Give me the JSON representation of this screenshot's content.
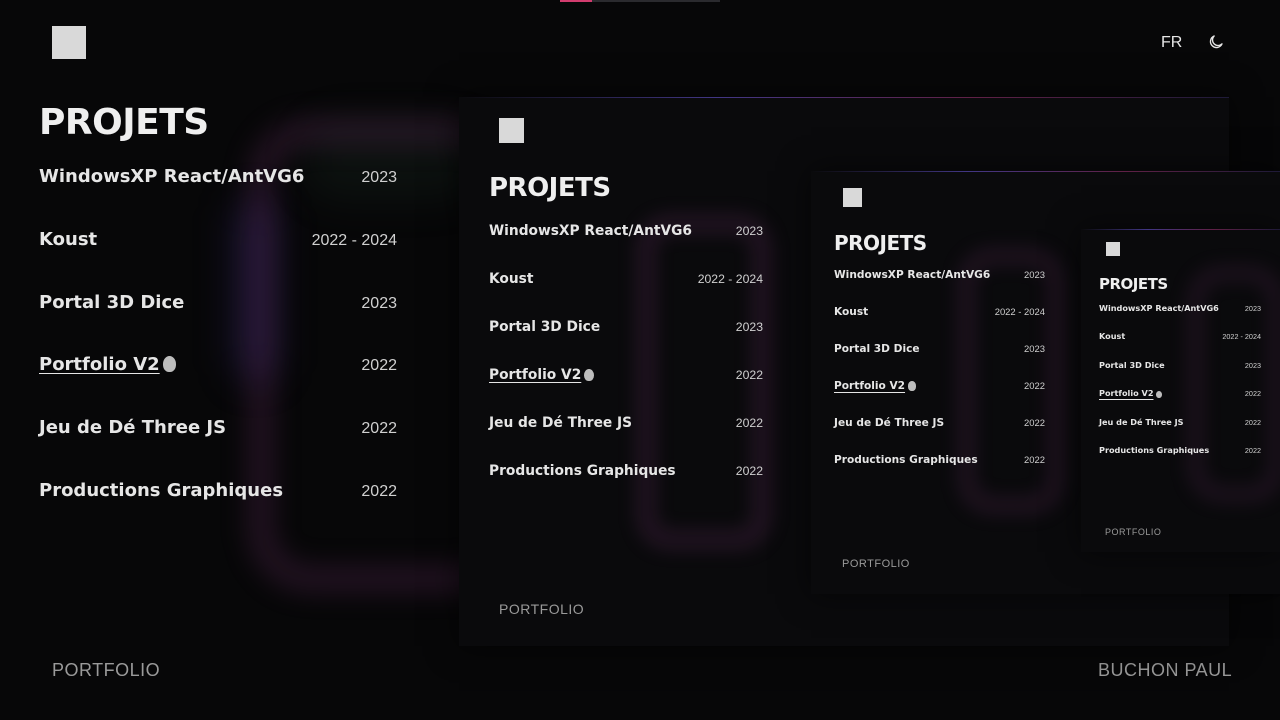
{
  "header": {
    "language_label": "FR",
    "theme_toggle_icon": "moon-icon",
    "progress": 0.2,
    "progress_color": "#d23c6e"
  },
  "main": {
    "title": "PROJETS",
    "projects": [
      {
        "name": "WindowsXP React/AntVG6",
        "year": "2023"
      },
      {
        "name": "Koust",
        "year": "2022 - 2024"
      },
      {
        "name": "Portal 3D Dice",
        "year": "2023"
      },
      {
        "name": "Portfolio V2",
        "year": "2022"
      },
      {
        "name": "Jeu de Dé Three JS",
        "year": "2022"
      },
      {
        "name": "Productions Graphiques",
        "year": "2022"
      }
    ]
  },
  "footer": {
    "left": "PORTFOLIO",
    "right": "BUCHON PAUL"
  },
  "colors": {
    "background": "#070708",
    "glow": "#a04696",
    "accent": "#d23c6e"
  }
}
